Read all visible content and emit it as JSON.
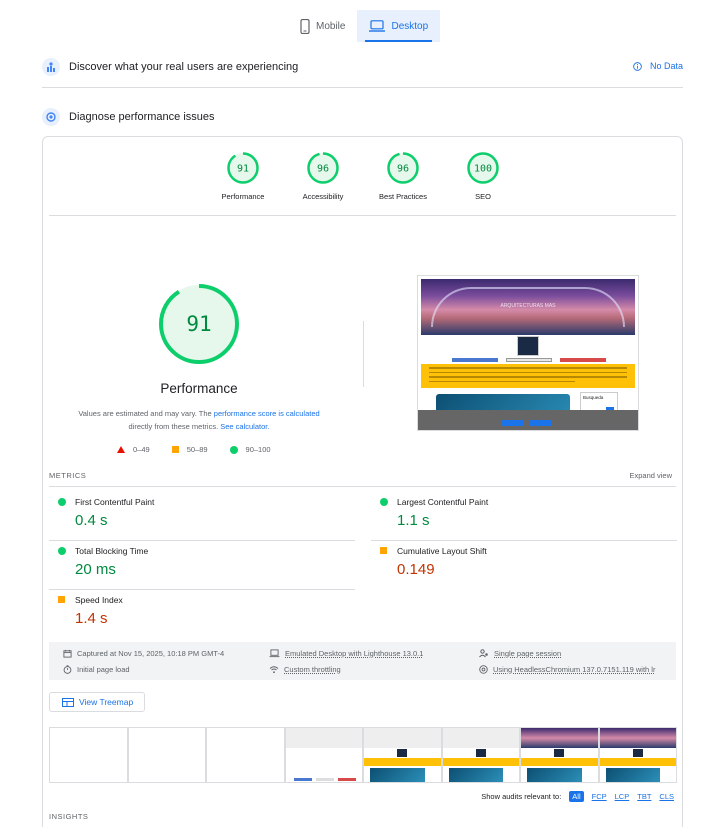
{
  "device_tabs": [
    {
      "label": "Mobile",
      "icon": "phone-icon",
      "active": false
    },
    {
      "label": "Desktop",
      "icon": "laptop-icon",
      "active": true
    }
  ],
  "discover": {
    "title": "Discover what your real users are experiencing",
    "no_data": "No Data"
  },
  "diagnose": {
    "title": "Diagnose performance issues"
  },
  "categories": [
    {
      "score": "91",
      "label": "Performance"
    },
    {
      "score": "96",
      "label": "Accessibility"
    },
    {
      "score": "96",
      "label": "Best Practices"
    },
    {
      "score": "100",
      "label": "SEO"
    }
  ],
  "main_gauge": {
    "score": "91",
    "label": "Performance",
    "fraction": 0.91
  },
  "disclaimer": {
    "part1": "Values are estimated and may vary. The ",
    "link1": "performance score is calculated",
    "part2": " directly from these metrics. ",
    "link2": "See calculator."
  },
  "legend": [
    {
      "range": "0–49",
      "shape": "triangle",
      "color": "#eb0f00"
    },
    {
      "range": "50–89",
      "shape": "square",
      "color": "#ffa400"
    },
    {
      "range": "90–100",
      "shape": "circle",
      "color": "#0cce6b"
    }
  ],
  "thumbnail": {
    "hero_title": "ARQUITECTURAS MAS",
    "side_title": "Busqueda"
  },
  "metrics_section": {
    "header": "METRICS",
    "expand": "Expand view"
  },
  "metrics": [
    {
      "title": "First Contentful Paint",
      "value": "0.4 s",
      "status": "good"
    },
    {
      "title": "Largest Contentful Paint",
      "value": "1.1 s",
      "status": "good"
    },
    {
      "title": "Total Blocking Time",
      "value": "20 ms",
      "status": "good"
    },
    {
      "title": "Cumulative Layout Shift",
      "value": "0.149",
      "status": "average"
    },
    {
      "title": "Speed Index",
      "value": "1.4 s",
      "status": "average"
    }
  ],
  "info": {
    "captured": "Captured at Nov 15, 2025, 10:18 PM GMT-4",
    "initial_load": "Initial page load",
    "emulated": "Emulated Desktop with Lighthouse 13.0.1",
    "throttling": "Custom throttling",
    "session": "Single page session",
    "browser": "Using HeadlessChromium 137.0.7151.119 with lr"
  },
  "treemap": {
    "label": "View Treemap"
  },
  "audits_filter": {
    "label": "Show audits relevant to:",
    "chips": [
      "All",
      "FCP",
      "LCP",
      "TBT",
      "CLS"
    ]
  },
  "insights": {
    "header": "INSIGHTS"
  },
  "colors": {
    "accent": "#1a73e8",
    "good": "#0cce6b",
    "average": "#ffa400",
    "poor": "#eb0f00"
  }
}
